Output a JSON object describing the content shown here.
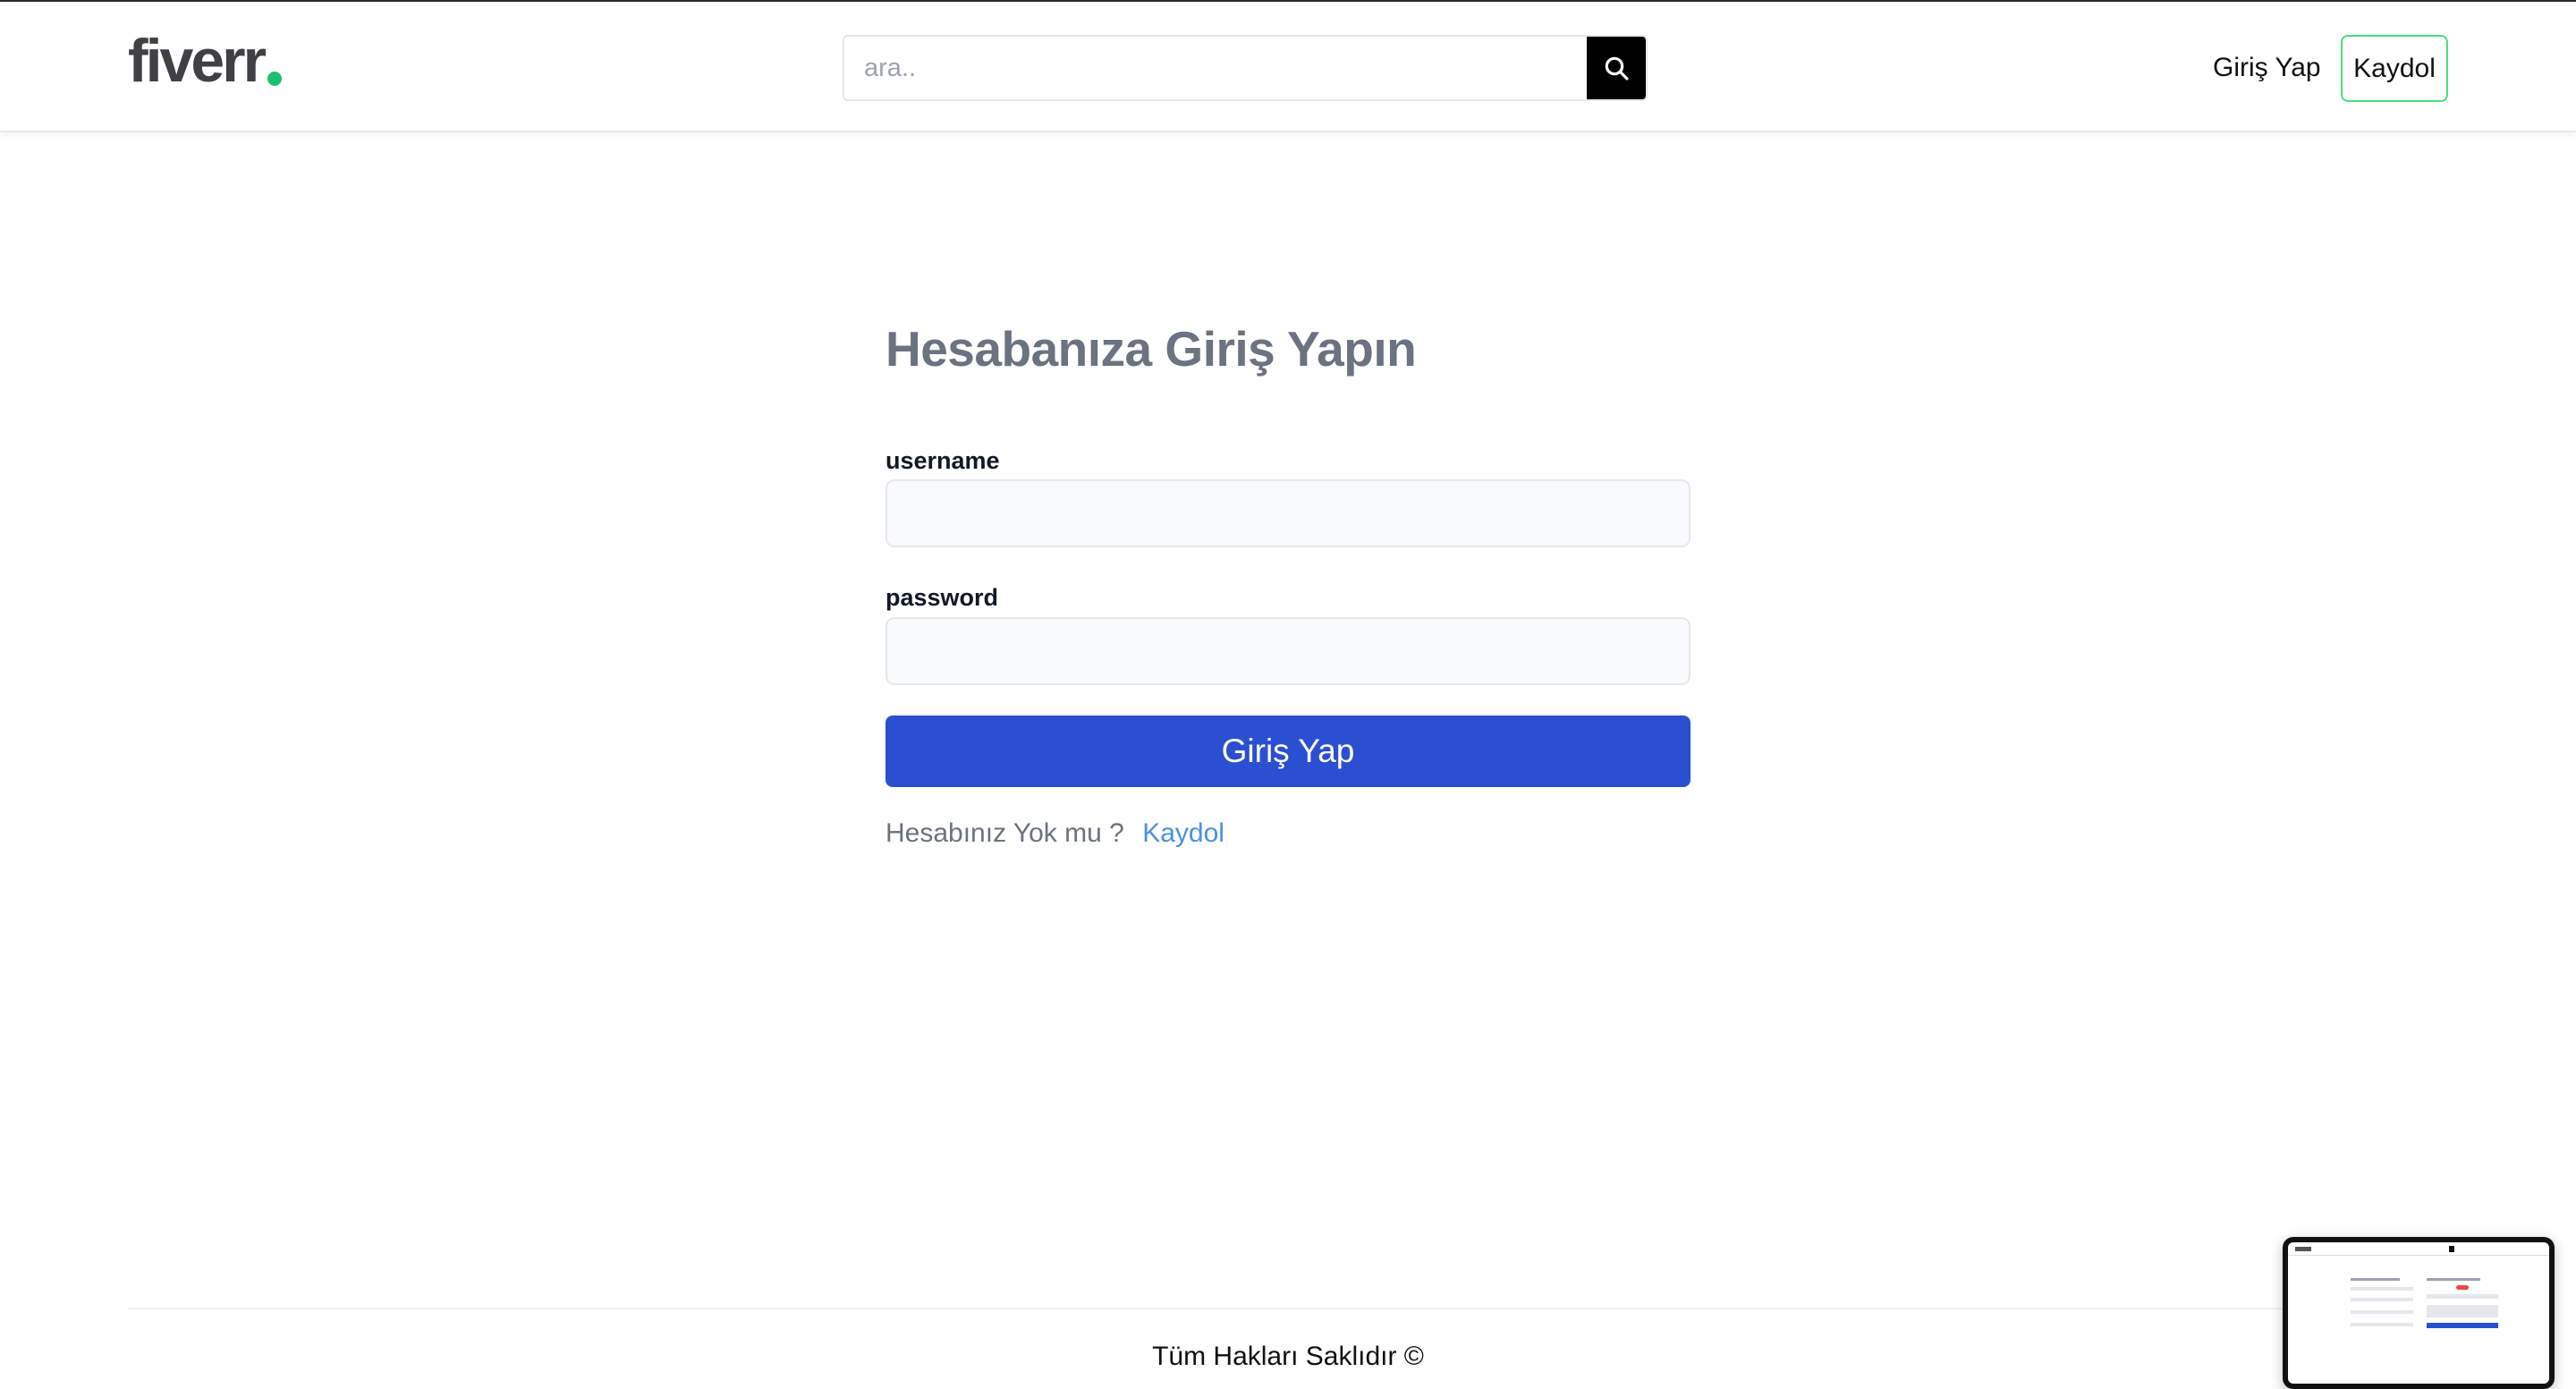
{
  "header": {
    "logo_text": "fiverr",
    "logo_dot_color": "#1dbf73",
    "search": {
      "placeholder": "ara..",
      "value": ""
    },
    "nav": {
      "login_label": "Giriş Yap",
      "signup_label": "Kaydol"
    }
  },
  "login_form": {
    "title": "Hesabanıza Giriş Yapın",
    "username_label": "username",
    "username_value": "",
    "password_label": "password",
    "password_value": "",
    "submit_label": "Giriş Yap",
    "no_account_text": "Hesabınız Yok mu ?",
    "signup_link": "Kaydol"
  },
  "footer": {
    "text": "Tüm Hakları Saklıdır ©"
  },
  "colors": {
    "primary_button": "#2b4fd1",
    "link": "#4a90e2",
    "signup_border": "#4ade80",
    "title": "#6b7280"
  }
}
